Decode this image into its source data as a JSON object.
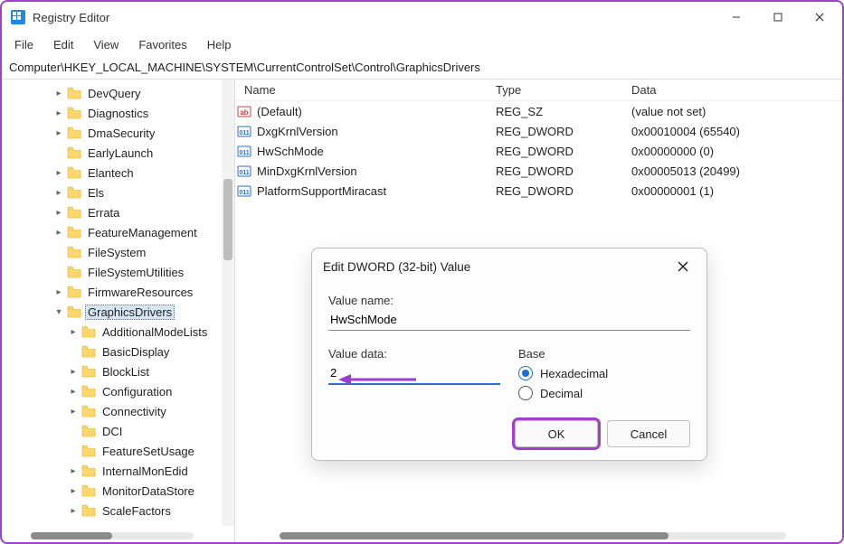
{
  "window": {
    "title": "Registry Editor"
  },
  "menu": {
    "file": "File",
    "edit": "Edit",
    "view": "View",
    "favorites": "Favorites",
    "help": "Help"
  },
  "address": "Computer\\HKEY_LOCAL_MACHINE\\SYSTEM\\CurrentControlSet\\Control\\GraphicsDrivers",
  "tree": [
    {
      "label": "DevQuery",
      "indent": 3,
      "expandable": true
    },
    {
      "label": "Diagnostics",
      "indent": 3,
      "expandable": true
    },
    {
      "label": "DmaSecurity",
      "indent": 3,
      "expandable": true
    },
    {
      "label": "EarlyLaunch",
      "indent": 3,
      "expandable": false
    },
    {
      "label": "Elantech",
      "indent": 3,
      "expandable": true
    },
    {
      "label": "Els",
      "indent": 3,
      "expandable": true
    },
    {
      "label": "Errata",
      "indent": 3,
      "expandable": true
    },
    {
      "label": "FeatureManagement",
      "indent": 3,
      "expandable": true
    },
    {
      "label": "FileSystem",
      "indent": 3,
      "expandable": false
    },
    {
      "label": "FileSystemUtilities",
      "indent": 3,
      "expandable": false
    },
    {
      "label": "FirmwareResources",
      "indent": 3,
      "expandable": true
    },
    {
      "label": "GraphicsDrivers",
      "indent": 3,
      "expandable": true,
      "expanded": true,
      "selected": true
    },
    {
      "label": "AdditionalModeLists",
      "indent": 4,
      "expandable": true
    },
    {
      "label": "BasicDisplay",
      "indent": 4,
      "expandable": false
    },
    {
      "label": "BlockList",
      "indent": 4,
      "expandable": true
    },
    {
      "label": "Configuration",
      "indent": 4,
      "expandable": true
    },
    {
      "label": "Connectivity",
      "indent": 4,
      "expandable": true
    },
    {
      "label": "DCI",
      "indent": 4,
      "expandable": false
    },
    {
      "label": "FeatureSetUsage",
      "indent": 4,
      "expandable": false
    },
    {
      "label": "InternalMonEdid",
      "indent": 4,
      "expandable": true
    },
    {
      "label": "MonitorDataStore",
      "indent": 4,
      "expandable": true
    },
    {
      "label": "ScaleFactors",
      "indent": 4,
      "expandable": true
    }
  ],
  "columns": {
    "name": "Name",
    "type": "Type",
    "data": "Data"
  },
  "values": [
    {
      "icon": "sz",
      "name": "(Default)",
      "type": "REG_SZ",
      "data": "(value not set)"
    },
    {
      "icon": "dw",
      "name": "DxgKrnlVersion",
      "type": "REG_DWORD",
      "data": "0x00010004 (65540)"
    },
    {
      "icon": "dw",
      "name": "HwSchMode",
      "type": "REG_DWORD",
      "data": "0x00000000 (0)"
    },
    {
      "icon": "dw",
      "name": "MinDxgKrnlVersion",
      "type": "REG_DWORD",
      "data": "0x00005013 (20499)"
    },
    {
      "icon": "dw",
      "name": "PlatformSupportMiracast",
      "type": "REG_DWORD",
      "data": "0x00000001 (1)"
    }
  ],
  "dialog": {
    "title": "Edit DWORD (32-bit) Value",
    "name_label": "Value name:",
    "name_value": "HwSchMode",
    "data_label": "Value data:",
    "data_value": "2",
    "base_label": "Base",
    "hex_label": "Hexadecimal",
    "dec_label": "Decimal",
    "base_selected": "hex",
    "ok": "OK",
    "cancel": "Cancel"
  }
}
